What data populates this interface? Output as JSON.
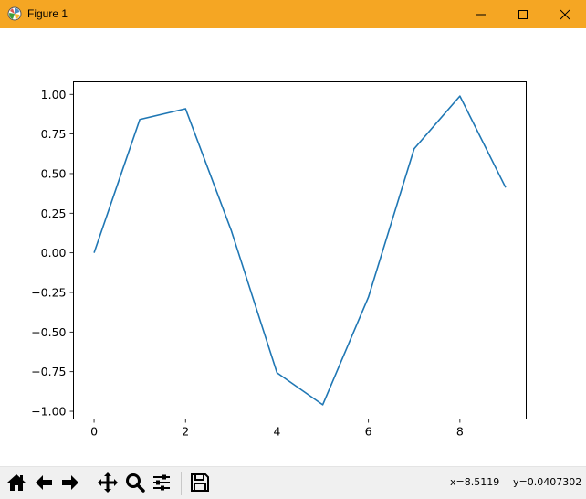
{
  "window": {
    "title": "Figure 1",
    "titlebar_color": "#f5a623",
    "controls": [
      "minimize-icon",
      "maximize-icon",
      "close-icon"
    ]
  },
  "toolbar": {
    "buttons": [
      "home-icon",
      "back-arrow-icon",
      "forward-arrow-icon",
      "pan-icon",
      "zoom-icon",
      "subplots-icon",
      "save-icon"
    ],
    "status": {
      "x": "x=8.5119",
      "y": "y=0.0407302"
    }
  },
  "chart_data": {
    "type": "line",
    "x": [
      0,
      1,
      2,
      3,
      4,
      5,
      6,
      7,
      8,
      9
    ],
    "series": [
      {
        "values": [
          0.0,
          0.8415,
          0.9093,
          0.1411,
          -0.7568,
          -0.9589,
          -0.2794,
          0.657,
          0.9894,
          0.4121
        ],
        "color": "#1f77b4"
      }
    ],
    "xticks": [
      "0",
      "2",
      "4",
      "6",
      "8"
    ],
    "yticks": [
      "1.00",
      "0.75",
      "0.50",
      "0.25",
      "0.00",
      "−0.25",
      "−0.50",
      "−0.75",
      "−1.00"
    ],
    "xlim": [
      -0.45,
      9.45
    ],
    "ylim": [
      -1.0489,
      1.0794
    ],
    "grid": false
  }
}
